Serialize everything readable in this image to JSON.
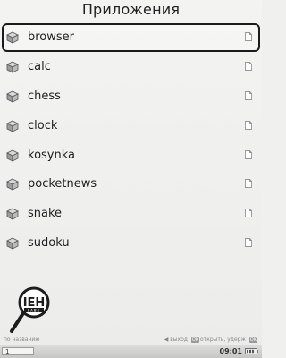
{
  "header": {
    "title": "Приложения"
  },
  "apps": [
    {
      "label": "browser",
      "selected": true
    },
    {
      "label": "calc",
      "selected": false
    },
    {
      "label": "chess",
      "selected": false
    },
    {
      "label": "clock",
      "selected": false
    },
    {
      "label": "kosynka",
      "selected": false
    },
    {
      "label": "pocketnews",
      "selected": false
    },
    {
      "label": "snake",
      "selected": false
    },
    {
      "label": "sudoku",
      "selected": false
    }
  ],
  "footer": {
    "sort_label": "по названию",
    "hints": {
      "exit_label": "выход",
      "open_key": "OK",
      "open_label": "открыть",
      "hold_label": "удерж",
      "hold_key": "OK"
    }
  },
  "logo": {
    "text": "ITEH LABS"
  },
  "status_bar": {
    "page": "1",
    "time": "09:01"
  }
}
